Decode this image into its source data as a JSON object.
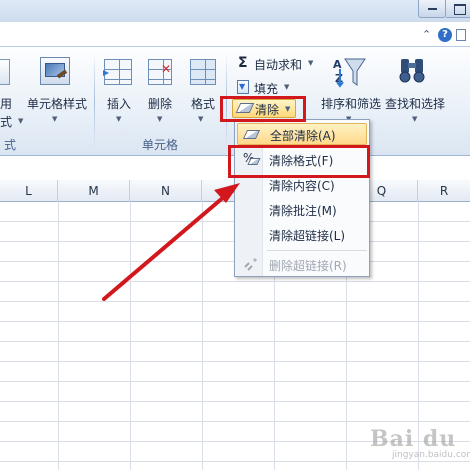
{
  "ribbon": {
    "left_cut_labels": [
      "用",
      "式"
    ],
    "cell_style_label": "单元格样式",
    "cells_group": {
      "label": "单元格",
      "insert": "插入",
      "delete": "删除",
      "format": "格式"
    },
    "left_group_label_cut": "式",
    "editing": {
      "autosum": "自动求和",
      "fill": "填充",
      "clear": "清除",
      "sort_filter": "排序和筛选",
      "find_select": "查找和选择"
    }
  },
  "clear_menu": {
    "items": [
      {
        "label": "全部清除(A)",
        "state": "hover"
      },
      {
        "label": "清除格式(F)",
        "state": "normal"
      },
      {
        "label": "清除内容(C)",
        "state": "normal"
      },
      {
        "label": "清除批注(M)",
        "state": "normal"
      },
      {
        "label": "清除超链接(L)",
        "state": "normal"
      },
      {
        "label": "删除超链接(R)",
        "state": "disabled"
      }
    ]
  },
  "columns": [
    "L",
    "M",
    "N",
    "O",
    "P",
    "Q",
    "R"
  ],
  "window": {
    "help": "?"
  },
  "watermark": {
    "text": "Bai du",
    "sub": "jingyan.baidu.com"
  },
  "colors": {
    "highlight": "#ffd98b",
    "annotation": "#d2171d",
    "ribbon": "#e9f0f8"
  }
}
